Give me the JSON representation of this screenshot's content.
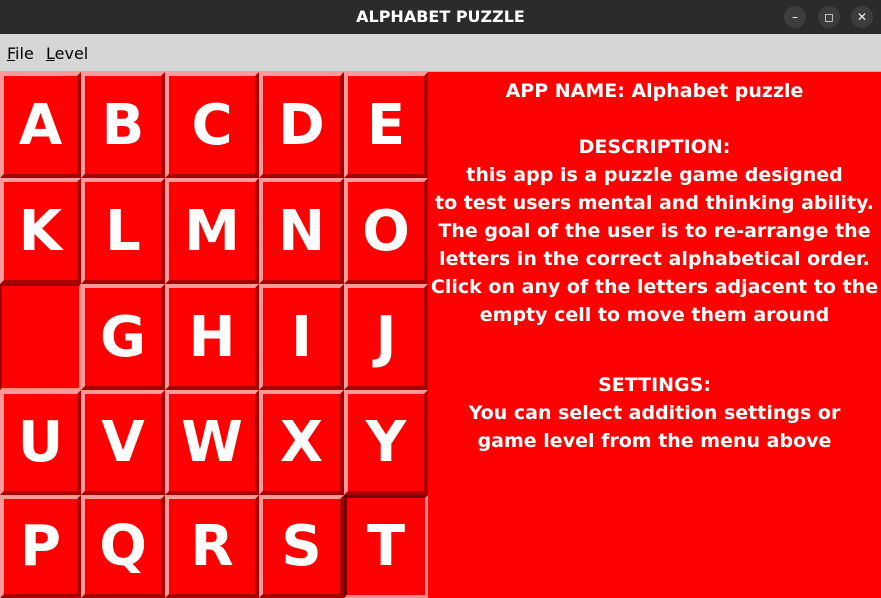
{
  "window": {
    "title": "ALPHABET PUZZLE",
    "controls": {
      "minimize": "–",
      "maximize": "◻",
      "close": "✕"
    }
  },
  "menu": [
    {
      "mnemonic": "F",
      "rest": "ile"
    },
    {
      "mnemonic": "L",
      "rest": "evel"
    }
  ],
  "board": {
    "rows": 5,
    "cols": 5,
    "tiles": [
      "A",
      "B",
      "C",
      "D",
      "E",
      "K",
      "L",
      "M",
      "N",
      "O",
      "",
      "G",
      "H",
      "I",
      "J",
      "U",
      "V",
      "W",
      "X",
      "Y",
      "P",
      "Q",
      "R",
      "S",
      "T"
    ]
  },
  "info": {
    "app_name": "APP NAME: Alphabet puzzle",
    "description_heading": "DESCRIPTION:",
    "description_lines": [
      "this app is a puzzle game designed",
      "to test users mental and thinking ability.",
      "The goal of the user is to re-arrange the",
      "letters in the correct alphabetical order.",
      "Click on any of the letters adjacent to the",
      "empty cell to move them around"
    ],
    "settings_heading": "SETTINGS:",
    "settings_lines": [
      "You can select addition settings or",
      "game level from the menu above"
    ]
  },
  "colors": {
    "tile_face": "#ff0000",
    "tile_text": "#ffffff",
    "titlebar": "#2b2b2b",
    "menubar": "#d6d6d6"
  }
}
